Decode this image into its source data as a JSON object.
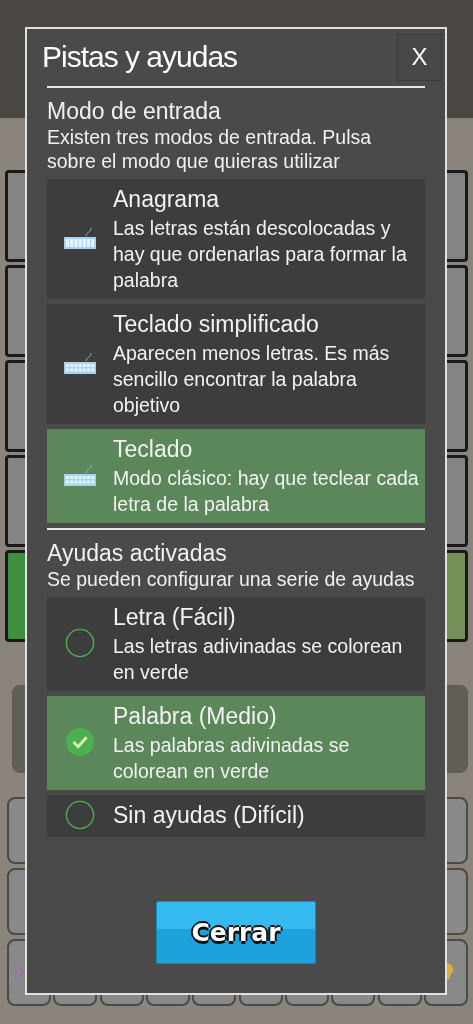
{
  "dialog": {
    "title": "Pistas y ayudas",
    "close_label": "X",
    "sections": [
      {
        "kind": "modes",
        "heading": "Modo de entrada",
        "description": "Existen tres modos de entrada. Pulsa sobre el modo que quieras utilizar",
        "options": [
          {
            "title": "Anagrama",
            "description": "Las letras están descolocadas y hay que ordenarlas para formar la palabra",
            "selected": false
          },
          {
            "title": "Teclado simplificado",
            "description": "Aparecen menos letras. Es más sencillo encontrar la palabra objetivo",
            "selected": false
          },
          {
            "title": "Teclado",
            "description": "Modo clásico: hay que teclear cada letra de la palabra",
            "selected": true
          }
        ]
      },
      {
        "kind": "helps",
        "heading": "Ayudas activadas",
        "description": "Se pueden configurar una serie de ayudas",
        "options": [
          {
            "title": "Letra (Fácil)",
            "description": "Las letras adivinadas se colorean en verde",
            "selected": false
          },
          {
            "title": "Palabra (Medio)",
            "description": "Las palabras adivinadas se colorean en verde",
            "selected": true
          },
          {
            "title": "Sin ayudas (Difícil)",
            "selected": false
          }
        ]
      }
    ],
    "button": "Cerrar"
  }
}
